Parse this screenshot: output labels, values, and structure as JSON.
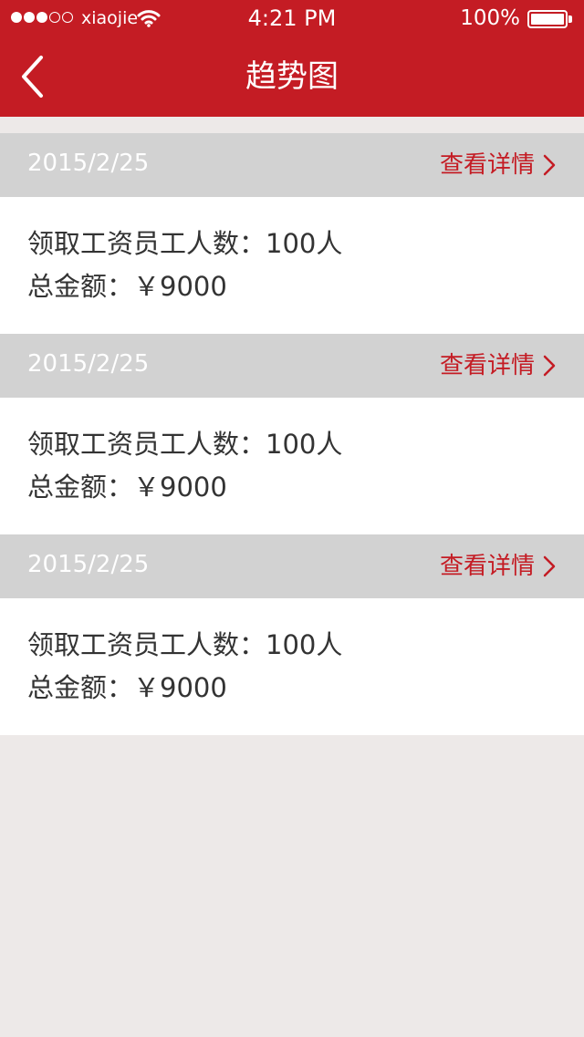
{
  "status_bar": {
    "carrier": "xiaojie",
    "time": "4:21 PM",
    "battery": "100%",
    "signal_bars_filled": 3,
    "signal_bars_total": 5
  },
  "nav": {
    "title": "趋势图",
    "back_icon": "chevron-left-icon"
  },
  "records": [
    {
      "date": "2015/2/25",
      "detail_label": "查看详情",
      "employees_label": "领取工资员工人数：100人",
      "amount_label": "总金额：￥9000"
    },
    {
      "date": "2015/2/25",
      "detail_label": "查看详情",
      "employees_label": "领取工资员工人数：100人",
      "amount_label": "总金额：￥9000"
    },
    {
      "date": "2015/2/25",
      "detail_label": "查看详情",
      "employees_label": "领取工资员工人数：100人",
      "amount_label": "总金额：￥9000"
    }
  ],
  "colors": {
    "brand_red": "#c41c24",
    "header_gray": "#d2d2d2",
    "page_bg": "#ede9e8"
  }
}
